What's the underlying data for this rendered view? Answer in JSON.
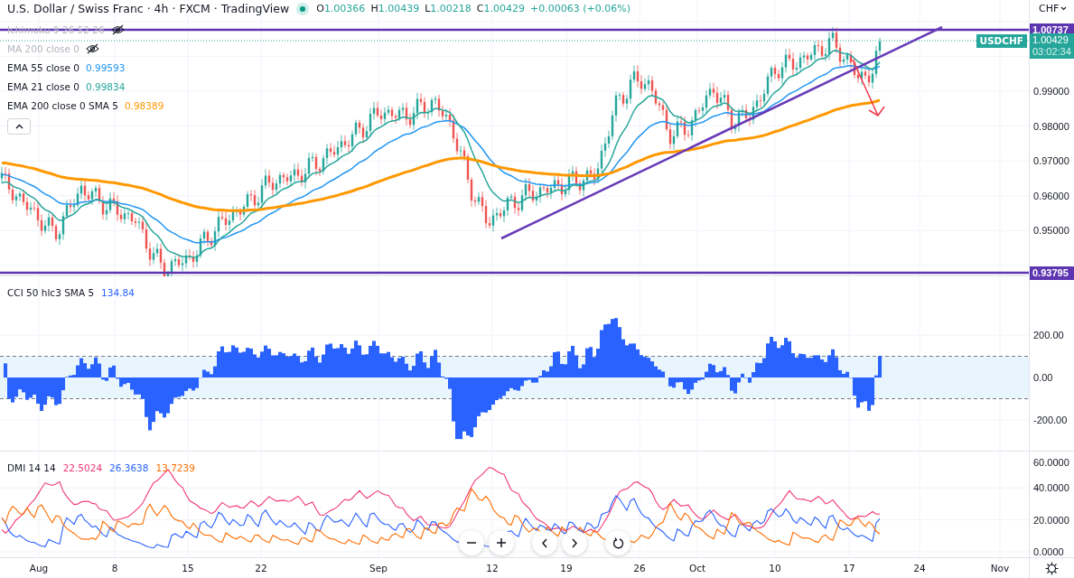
{
  "header": {
    "title": "U.S. Dollar / Swiss Franc · 4h · FXCM · TradingView",
    "ohlc": [
      {
        "label": "O",
        "value": "1.00366"
      },
      {
        "label": "H",
        "value": "1.00439"
      },
      {
        "label": "L",
        "value": "1.00218"
      },
      {
        "label": "C",
        "value": "1.00429"
      }
    ],
    "change": "+0.00063 (+0.06%)"
  },
  "indicators": [
    {
      "name": "Ichimoku 9 26 52 26",
      "hidden": true
    },
    {
      "name": "MA 200 close 0",
      "hidden": true
    },
    {
      "name": "EMA 55 close 0",
      "hidden": false,
      "value": "0.99593",
      "color": "#2196f3"
    },
    {
      "name": "EMA 21 close 0",
      "hidden": false,
      "value": "0.99834",
      "color": "#26a69a"
    },
    {
      "name": "EMA 200 close 0 SMA 5",
      "hidden": false,
      "value": "0.98389",
      "color": "#ff9800"
    }
  ],
  "price_axis": {
    "currency": "CHF",
    "ticks": [
      "0.99000",
      "0.98000",
      "0.97000",
      "0.96000",
      "0.95000"
    ],
    "levels": [
      "1.00737",
      "0.93795"
    ],
    "symbol": "USDCHF",
    "last_price": "1.00429",
    "countdown": "03:02:34"
  },
  "cci": {
    "name": "CCI 50 hlc3 SMA 5",
    "value": "134.84",
    "ticks": [
      "200.00",
      "0.00",
      "-200.00"
    ]
  },
  "dmi": {
    "name": "DMI 14 14",
    "values": [
      {
        "value": "22.5024",
        "color": "#f23674"
      },
      {
        "value": "26.3638",
        "color": "#2962ff"
      },
      {
        "value": "13.7239",
        "color": "#ff6d00"
      }
    ],
    "ticks": [
      "60.0000",
      "40.0000",
      "20.0000",
      "0.0000"
    ]
  },
  "time_axis": [
    "Aug",
    "8",
    "15",
    "22",
    "Sep",
    "12",
    "19",
    "26",
    "Oct",
    "10",
    "17",
    "24",
    "Nov"
  ]
}
